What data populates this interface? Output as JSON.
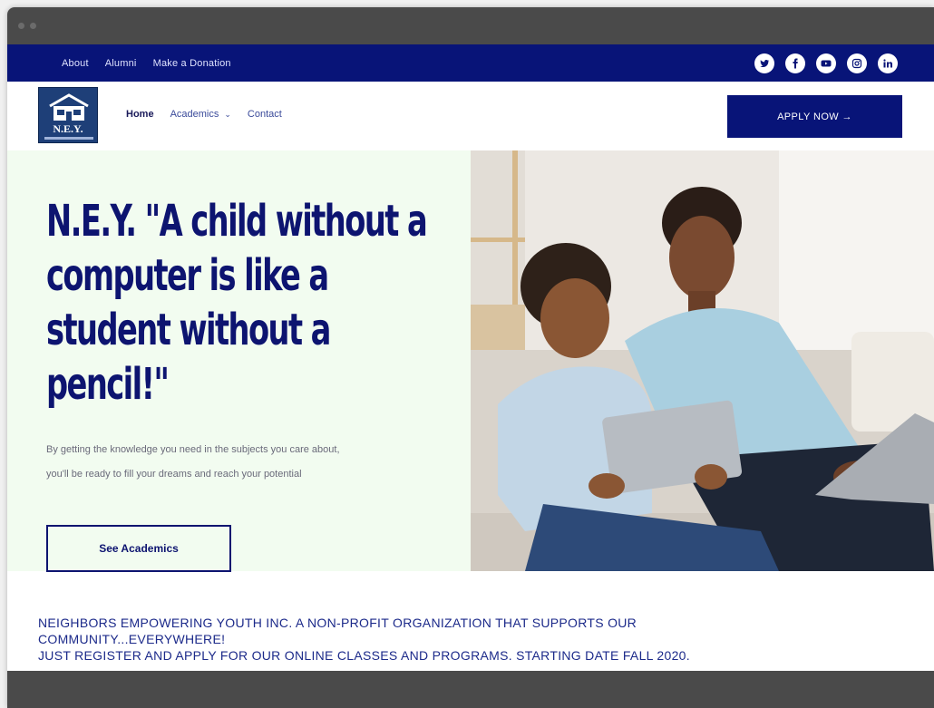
{
  "topbar": {
    "links": [
      "About",
      "Alumni",
      "Make a Donation"
    ],
    "socials": [
      "twitter-icon",
      "facebook-icon",
      "youtube-icon",
      "instagram-icon",
      "linkedin-icon"
    ]
  },
  "logo": {
    "text": "N.E.Y."
  },
  "nav": {
    "items": [
      "Home",
      "Academics",
      "Contact"
    ],
    "apply_label": "APPLY NOW →"
  },
  "hero": {
    "title": "N.E.Y. \"A child without a computer is like a student without a pencil!\"",
    "description": "By getting the knowledge you need in the subjects you care about, you'll be ready to fill your dreams and reach your potential",
    "button_label": "See Academics"
  },
  "announcement": {
    "line1": "NEIGHBORS EMPOWERING YOUTH INC. A NON-PROFIT ORGANIZATION THAT SUPPORTS OUR",
    "line2": "COMMUNITY...EVERYWHERE!",
    "line3": "JUST REGISTER AND APPLY FOR OUR ONLINE CLASSES AND PROGRAMS. STARTING DATE FALL 2020."
  },
  "colors": {
    "brand_navy": "#081478",
    "hero_bg": "#f2fcf0",
    "chrome": "#4a4a4a"
  }
}
